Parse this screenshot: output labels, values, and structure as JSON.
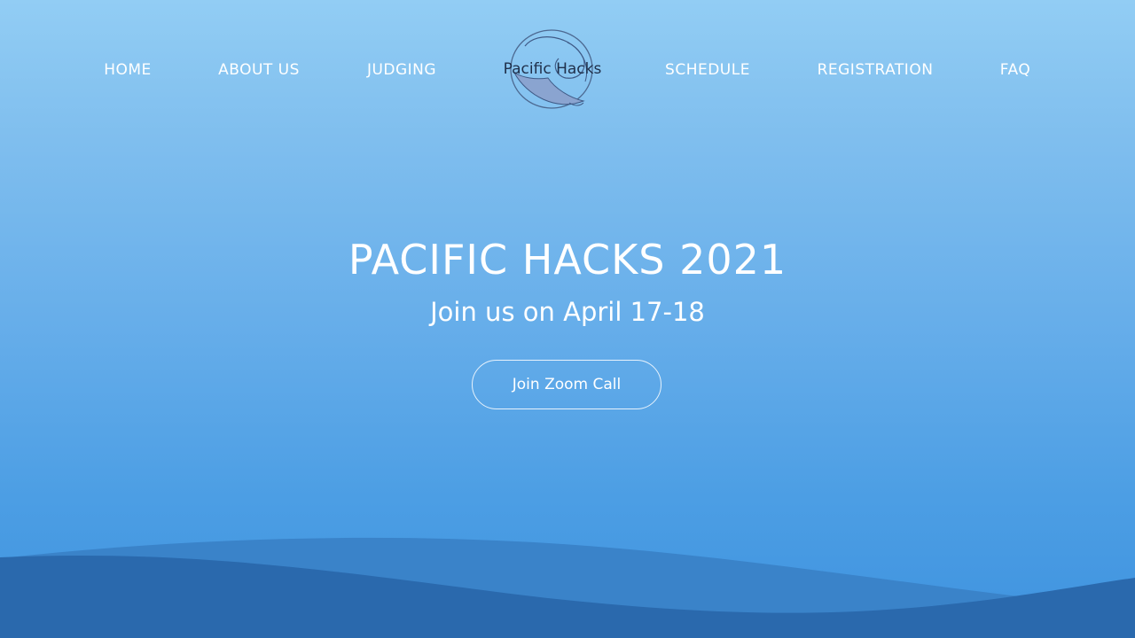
{
  "nav": {
    "items": [
      {
        "label": "HOME"
      },
      {
        "label": "ABOUT US"
      },
      {
        "label": "JUDGING"
      },
      {
        "label": "SCHEDULE"
      },
      {
        "label": "REGISTRATION"
      },
      {
        "label": "FAQ"
      }
    ],
    "logo": {
      "text": "Pacific Hacks",
      "icon": "whale-logo-icon"
    }
  },
  "hero": {
    "title": "PACIFIC HACKS 2021",
    "subtitle": "Join us on April 17-18",
    "button_label": "Join Zoom Call"
  },
  "colors": {
    "background_top": "#92cdf4",
    "background_bottom": "#3f93df",
    "wave_light": "#3a83c9",
    "wave_dark": "#2a69ad",
    "text": "#ffffff"
  }
}
